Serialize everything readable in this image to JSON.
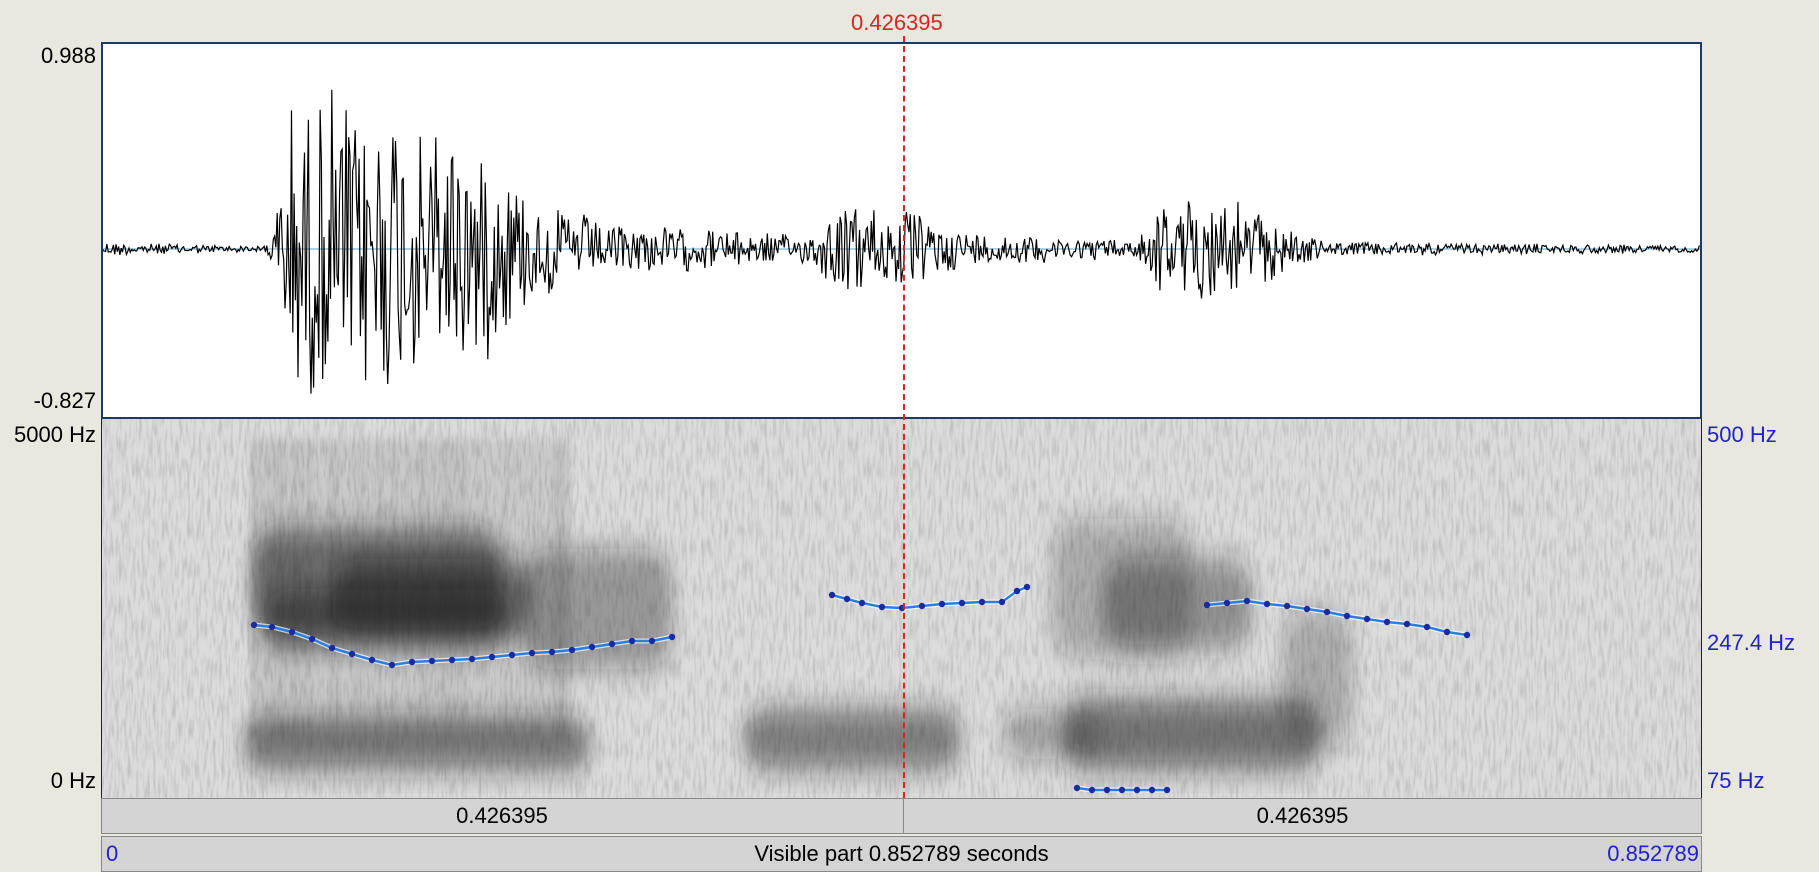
{
  "cursor": {
    "time_label": "0.426395",
    "color": "#dd2222"
  },
  "waveform": {
    "max_label": "0.988",
    "min_label": "-0.827"
  },
  "spectrogram": {
    "freq_top_label": "5000 Hz",
    "freq_bottom_label": "0 Hz"
  },
  "pitch": {
    "top_label": "500 Hz",
    "mid_label": "247.4 Hz",
    "bottom_label": "75 Hz",
    "color": "#2a7fe0"
  },
  "time_bar": {
    "left_segment_label": "0.426395",
    "right_segment_label": "0.426395",
    "start_label": "0",
    "end_label": "0.852789",
    "visible_label": "Visible part 0.852789 seconds"
  },
  "colors": {
    "background": "#e8e8df",
    "panel_border": "#1b3a66",
    "axis_blue": "#2222cc"
  }
}
